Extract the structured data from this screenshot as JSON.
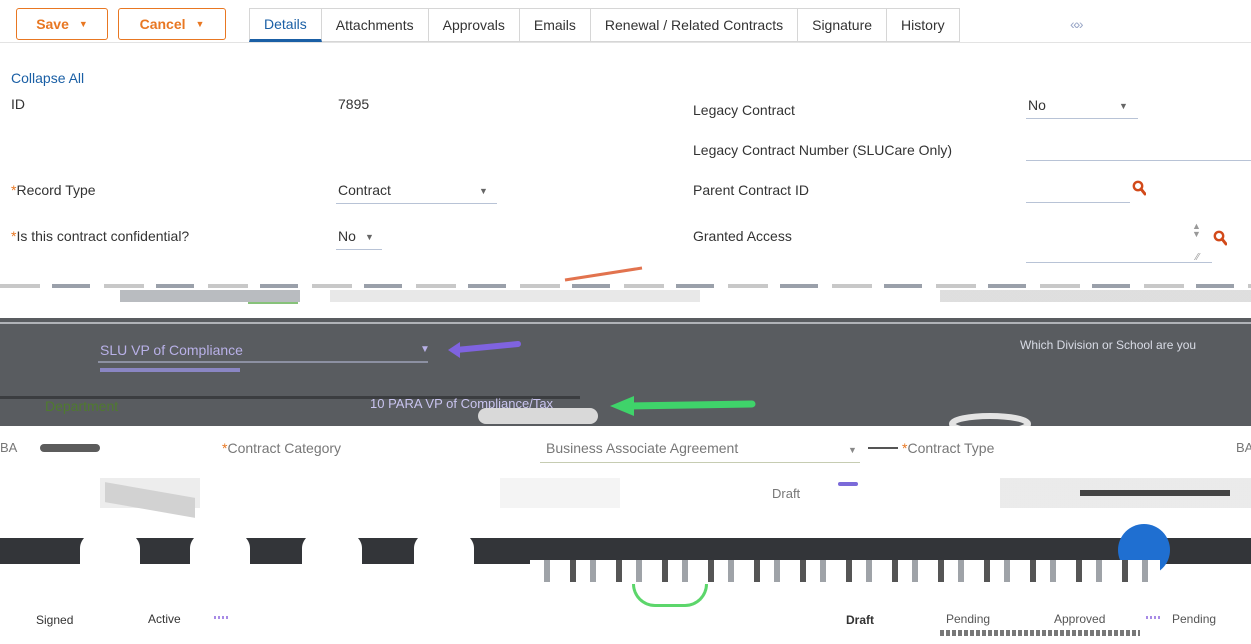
{
  "toolbar": {
    "save_label": "Save",
    "cancel_label": "Cancel"
  },
  "tabs": [
    {
      "label": "Details",
      "active": true
    },
    {
      "label": "Attachments"
    },
    {
      "label": "Approvals"
    },
    {
      "label": "Emails"
    },
    {
      "label": "Renewal / Related Contracts"
    },
    {
      "label": "Signature"
    },
    {
      "label": "History"
    }
  ],
  "tab_nav_glyph": "«»",
  "collapse_all": "Collapse All",
  "fields": {
    "id": {
      "label": "ID",
      "value": "7895"
    },
    "record_type": {
      "label": "Record Type",
      "value": "Contract"
    },
    "confidential": {
      "label": "Is this contract confidential?",
      "value": "No"
    },
    "legacy_contract": {
      "label": "Legacy Contract",
      "value": "No"
    },
    "legacy_number": {
      "label": "Legacy Contract Number (SLUCare Only)",
      "value": ""
    },
    "parent_id": {
      "label": "Parent Contract ID",
      "value": ""
    },
    "granted_access": {
      "label": "Granted Access",
      "value": ""
    }
  },
  "garbled": {
    "vp_compliance": "SLU VP of Compliance",
    "which_division": "Which Division or School are you",
    "department": "Department",
    "department_value": "10 PARA VP of Compliance/Tax",
    "contract_category_label": "Contract Category",
    "contract_category_value": "Business Associate Agreement",
    "contract_type_label": "Contract Type",
    "draft": "Draft",
    "row_prefix": "BA",
    "row_prefix2": "BA"
  },
  "stages_bottom": [
    {
      "label": "Signed"
    },
    {
      "label": "Active"
    },
    {
      "label": "Draft"
    },
    {
      "label": "Pending"
    },
    {
      "label": "Approved"
    },
    {
      "label": "Pending"
    }
  ],
  "colors": {
    "accent": "#e87722",
    "link": "#1a5fa5",
    "required": "#e87722",
    "search_icon": "#d24a1a",
    "gray_band": "#5a5a5a"
  }
}
